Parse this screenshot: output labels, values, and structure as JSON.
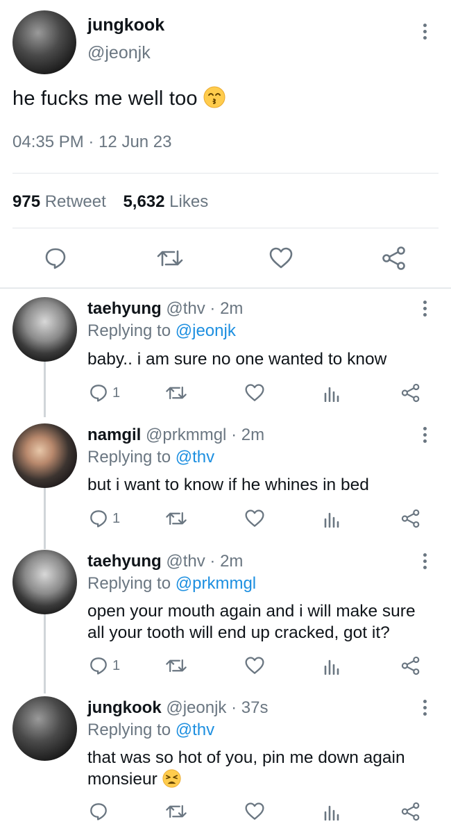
{
  "main": {
    "name": "jungkook",
    "handle": "@jeonjk",
    "text": "he fucks me well too",
    "time": "04:35 PM",
    "sep": "·",
    "date": "12 Jun 23",
    "retweets": "975",
    "retweet_label": "Retweet",
    "likes": "5,632",
    "likes_label": "Likes"
  },
  "replies": [
    {
      "name": "taehyung",
      "handle": "@thv",
      "time": "· 2m",
      "reply_prefix": "Replying to",
      "reply_to": "@jeonjk",
      "lines": [
        "baby.. i am sure no one wanted to know"
      ],
      "reply_count": "1"
    },
    {
      "name": "namgil",
      "handle": "@prkmmgl",
      "time": "· 2m",
      "reply_prefix": "Replying to",
      "reply_to": "@thv",
      "lines": [
        "but i want to know if he whines in bed"
      ],
      "reply_count": "1"
    },
    {
      "name": "taehyung",
      "handle": "@thv",
      "time": "· 2m",
      "reply_prefix": "Replying to",
      "reply_to": "@prkmmgl",
      "lines": [
        "open your mouth again and i will make sure",
        "all your tooth will end up cracked, got it?"
      ],
      "reply_count": "1"
    },
    {
      "name": "jungkook",
      "handle": "@jeonjk",
      "time": "· 37s",
      "reply_prefix": "Replying to",
      "reply_to": "@thv",
      "lines": [
        "that was so hot of you, pin me down again",
        "monsieur"
      ],
      "reply_count": ""
    }
  ],
  "colors": {
    "link": "#1d8fe0",
    "muted": "#6a7681",
    "divider": "#e3e6e9"
  },
  "icons": [
    "more-icon",
    "reply-icon",
    "retweet-icon",
    "like-icon",
    "share-icon",
    "analytics-icon",
    "kissing-emoji",
    "weary-emoji"
  ]
}
